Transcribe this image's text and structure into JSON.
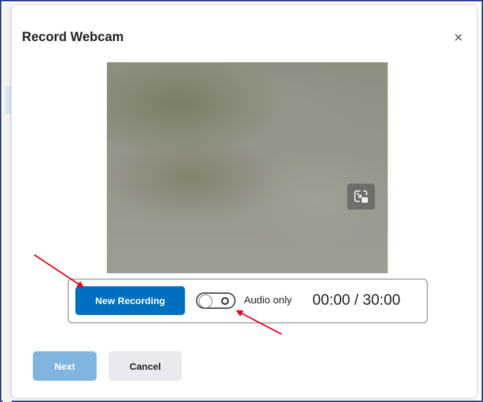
{
  "dialog": {
    "title": "Record Webcam",
    "close_label": "×"
  },
  "video": {
    "pip_icon": "picture-in-picture-icon"
  },
  "controls": {
    "new_recording_label": "New Recording",
    "audio_only_label": "Audio only",
    "audio_only_enabled": false,
    "timer": "00:00 / 30:00"
  },
  "footer": {
    "next_label": "Next",
    "cancel_label": "Cancel"
  },
  "colors": {
    "primary": "#006fbf",
    "primary_disabled": "#7fb5de",
    "annotation_arrow": "#e3001b"
  }
}
